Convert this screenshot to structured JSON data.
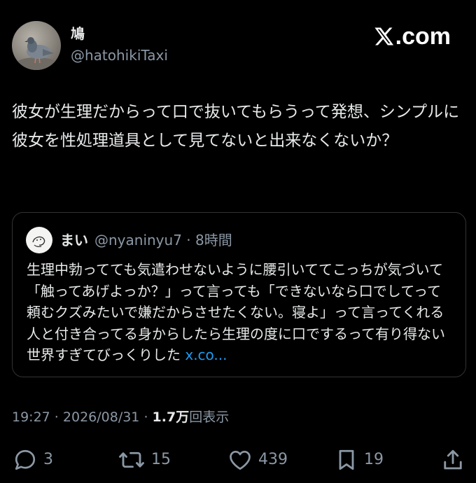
{
  "author": {
    "display_name": "鳩",
    "handle": "@hatohikiTaxi"
  },
  "brand": {
    "logo_text": ".com",
    "logo_icon": "x-logo-icon"
  },
  "tweet": {
    "text": "彼女が生理だからって口で抜いてもらうって発想、シンプルに彼女を性処理道具として見てないと出来なくないか？"
  },
  "quote": {
    "display_name": "まい",
    "handle": "@nyaninyu7",
    "separator": "·",
    "time": "8時間",
    "text": "生理中勃ってても気遣わせないように腰引いててこっちが気づいて「触ってあげよっか？」って言っても「できないなら口でしてって頼むクズみたいで嫌だからさせたくない。寝よ」って言ってくれる人と付き合ってる身からしたら生理の度に口でするって有り得ない世界すぎてびっくりした ",
    "link_text": "x.co..."
  },
  "meta": {
    "time": "19:27",
    "sep1": " · ",
    "date": "2026/08/31",
    "sep2": " · ",
    "views_count": "1.7万",
    "views_label": "回表示"
  },
  "actions": {
    "replies": "3",
    "retweets": "15",
    "likes": "439",
    "bookmarks": "19"
  },
  "colors": {
    "background": "#000000",
    "text": "#e7e9ea",
    "secondary": "#8b98a5",
    "link": "#1d9bf0",
    "border": "#2f3336"
  }
}
